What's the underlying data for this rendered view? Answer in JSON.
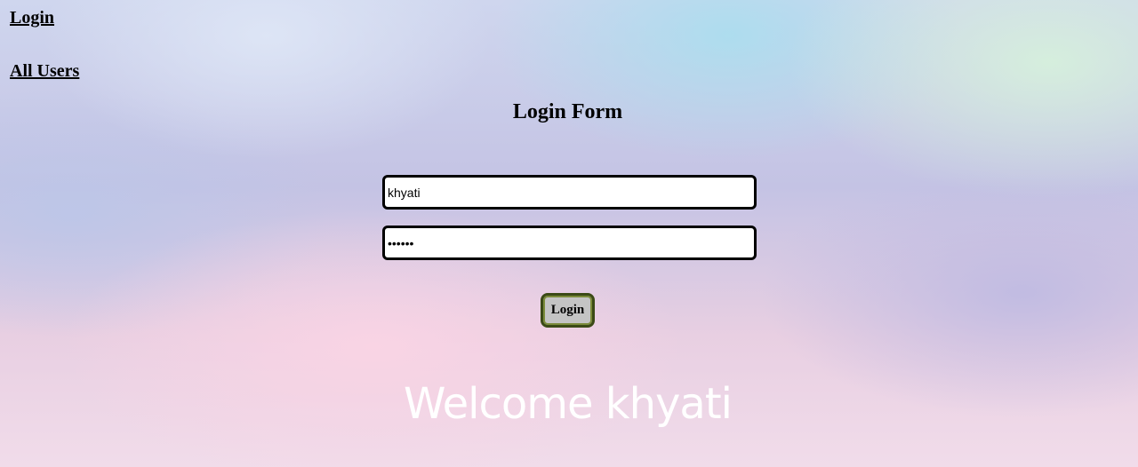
{
  "nav": {
    "login_link": "Login",
    "all_users_link": "All Users"
  },
  "form": {
    "title": "Login Form",
    "username_value": "khyati",
    "password_value": "••••••",
    "submit_label": "Login"
  },
  "welcome": {
    "message": "Welcome khyati"
  },
  "colors": {
    "button_border": "#3b4a16",
    "button_fill": "#c4c4c4",
    "welcome_text": "#ffffff"
  }
}
